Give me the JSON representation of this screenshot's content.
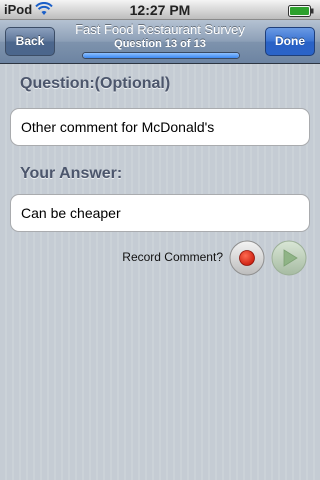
{
  "status_bar": {
    "carrier": "iPod",
    "time": "12:27 PM",
    "wifi_icon": "wifi-icon",
    "battery_icon": "battery-icon"
  },
  "nav": {
    "back_label": "Back",
    "done_label": "Done",
    "title": "Fast Food Restaurant Survey",
    "subtitle": "Question 13 of 13",
    "progress": 1.0
  },
  "question": {
    "label": "Question:(Optional)",
    "text": "Other comment for McDonald's"
  },
  "answer": {
    "label": "Your Answer:",
    "value": "Can be cheaper"
  },
  "record": {
    "label": "Record Comment?",
    "record_icon": "record-icon",
    "play_icon": "play-icon"
  },
  "colors": {
    "nav_bar": "#7e93ad",
    "done_button": "#2962c6",
    "label_text": "#4c566c",
    "record_red": "#e0281a",
    "play_green": "#a8cfa0"
  }
}
